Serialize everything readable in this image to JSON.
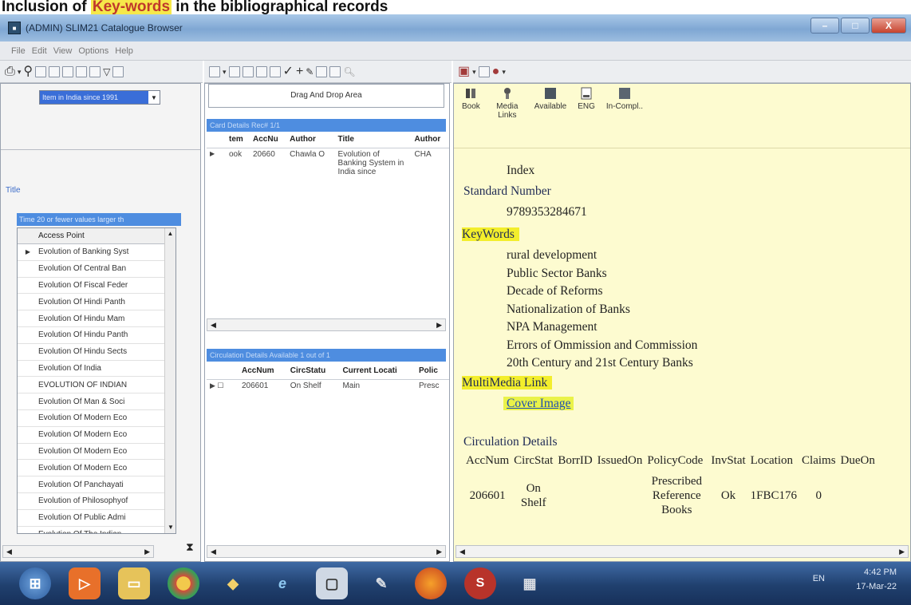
{
  "caption": {
    "before": "Inclusion of ",
    "highlight": "Key-words",
    "after": " in the bibliographical records"
  },
  "window": {
    "title": "(ADMIN) SLIM21 Catalogue Browser",
    "minimize": "–",
    "maximize": "□",
    "close": "X"
  },
  "menu": [
    "File",
    "Edit",
    "View",
    "Options",
    "Help"
  ],
  "left": {
    "combo_value": "Item in India since 1991",
    "title_label": "Title",
    "filter_text": "Time 20 or fewer values larger th",
    "column_header": "Access Point",
    "rows": [
      "Evolution of Banking Syst",
      "Evolution Of Central Ban",
      "Evolution Of Fiscal Feder",
      "Evolution Of Hindi Panth",
      "Evolution Of Hindu Mam",
      "Evolution Of Hindu Panth",
      "Evolution Of Hindu Sects",
      "Evolution Of India",
      "EVOLUTION OF INDIAN",
      "Evolution Of Man & Soci",
      "Evolution Of Modern Eco",
      "Evolution Of Modern Eco",
      "Evolution Of Modern Eco",
      "Evolution Of Modern Eco",
      "Evolution Of Panchayati",
      "Evolution of Philosophyof",
      "Evolution Of Public Admi",
      "Evolution Of The Indian"
    ]
  },
  "middle": {
    "drag_drop": "Drag And Drop Area",
    "card_header": "Card Details  Rec# 1/1",
    "card_columns": [
      "tem",
      "AccNu",
      "Author",
      "Title",
      "Author"
    ],
    "card_row": {
      "item": "ook",
      "accno": "20660",
      "author": "Chawla O",
      "title": "Evolution of Banking System in India since",
      "author2": "CHA"
    },
    "circ_header": "Circulation Details  Available 1 out of 1",
    "circ_columns": [
      "AccNum",
      "CircStatu",
      "Current Locati",
      "Polic"
    ],
    "circ_row": {
      "accnum": "206601",
      "status": "On Shelf",
      "location": "Main",
      "policy": "Presc"
    }
  },
  "right": {
    "icons": [
      {
        "label": "Book",
        "icon": "book-icon"
      },
      {
        "label": "Media Links",
        "icon": "media-icon"
      },
      {
        "label": "Available",
        "icon": "available-icon"
      },
      {
        "label": "ENG",
        "icon": "language-icon"
      },
      {
        "label": "In-Compl..",
        "icon": "incomplete-icon"
      }
    ],
    "index": "Index",
    "standard_number_label": "Standard Number",
    "standard_number": "9789353284671",
    "keywords_label": "KeyWords",
    "keywords": [
      "rural development",
      "Public Sector Banks",
      "Decade of Reforms",
      "Nationalization of Banks",
      "NPA Management",
      "Errors of Ommission and Commission",
      "20th Century and 21st Century Banks"
    ],
    "multimedia_label": "MultiMedia Link",
    "multimedia_link": "Cover Image",
    "circulation_label": "Circulation Details",
    "circ_columns": [
      "AccNum",
      "CircStat",
      "BorrID",
      "IssuedOn",
      "PolicyCode",
      "InvStat",
      "Location",
      "Claims",
      "DueOn"
    ],
    "circ_row": {
      "accnum": "206601",
      "status": "On Shelf",
      "borrid": "",
      "issued": "",
      "policy": "Prescribed Reference Books",
      "invstat": "Ok",
      "location": "1FBC176",
      "claims": "0",
      "due": ""
    }
  },
  "taskbar": {
    "lang": "EN",
    "time": "4:42 PM",
    "date": "17-Mar-22"
  }
}
